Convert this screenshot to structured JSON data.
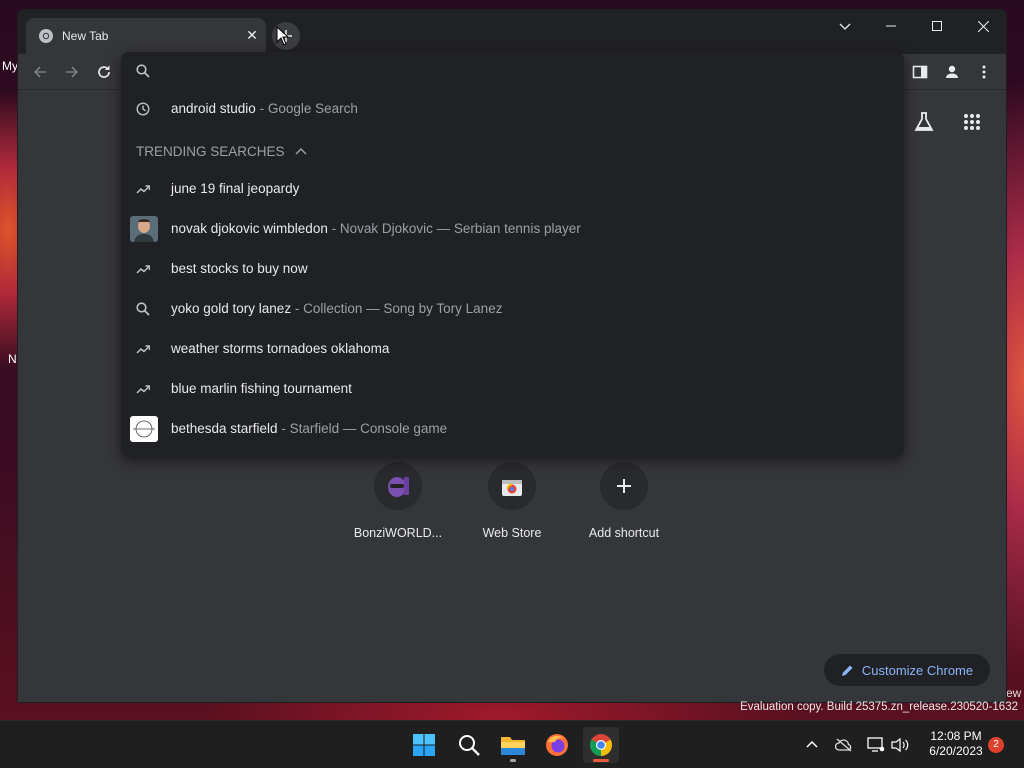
{
  "desktop": {
    "label_fragment_1": "My",
    "label_fragment_2": "N",
    "edge_fragment": "ew"
  },
  "browser": {
    "tab": {
      "title": "New Tab",
      "close_icon": "close-icon",
      "favicon": "chrome-icon"
    },
    "new_tab_icon": "plus-icon",
    "window_controls": {
      "tab_search": "chevron-down-icon",
      "minimize": "minimize-icon",
      "maximize": "maximize-icon",
      "close": "close-icon"
    },
    "toolbar": {
      "back": "arrow-left-icon",
      "forward": "arrow-right-icon",
      "reload": "reload-icon",
      "side_panel": "side-panel-icon",
      "profile": "profile-icon",
      "menu": "kebab-menu-icon"
    }
  },
  "omnibox": {
    "input_value": "",
    "input_placeholder": "",
    "trending_header": "TRENDING SEARCHES",
    "suggestions": [
      {
        "icon": "history-icon",
        "text": "android studio",
        "desc": "- Google Search"
      },
      {
        "icon": "trending-icon",
        "text": "june 19 final jeopardy",
        "desc": ""
      },
      {
        "icon": "thumbnail",
        "text": "novak djokovic wimbledon",
        "desc": "- Novak Djokovic — Serbian tennis player"
      },
      {
        "icon": "trending-icon",
        "text": "best stocks to buy now",
        "desc": ""
      },
      {
        "icon": "search-icon",
        "text": "yoko gold tory lanez",
        "desc": "- Collection — Song by Tory Lanez"
      },
      {
        "icon": "trending-icon",
        "text": "weather storms tornadoes oklahoma",
        "desc": ""
      },
      {
        "icon": "trending-icon",
        "text": "blue marlin fishing tournament",
        "desc": ""
      },
      {
        "icon": "thumbnail",
        "text": "bethesda starfield",
        "desc": "- Starfield — Console game"
      }
    ]
  },
  "ntp": {
    "labs_icon": "flask-icon",
    "apps_icon": "apps-grid-icon",
    "shortcuts": [
      {
        "label": "BonziWORLD...",
        "icon": "bonzi-icon"
      },
      {
        "label": "Web Store",
        "icon": "webstore-icon"
      },
      {
        "label": "Add shortcut",
        "icon": "plus-icon"
      }
    ],
    "customize_label": "Customize Chrome"
  },
  "watermark": "Evaluation copy. Build 25375.zn_release.230520-1632",
  "taskbar": {
    "apps": [
      "windows-start-icon",
      "search-icon",
      "file-explorer-icon",
      "firefox-icon",
      "chrome-icon"
    ],
    "time": "12:08 PM",
    "date": "6/20/2023",
    "notification_count": "2"
  },
  "colors": {
    "accent_blue": "#8ab4f8",
    "surface": "#35363a",
    "dropdown": "#202124",
    "badge": "#e0412c"
  }
}
